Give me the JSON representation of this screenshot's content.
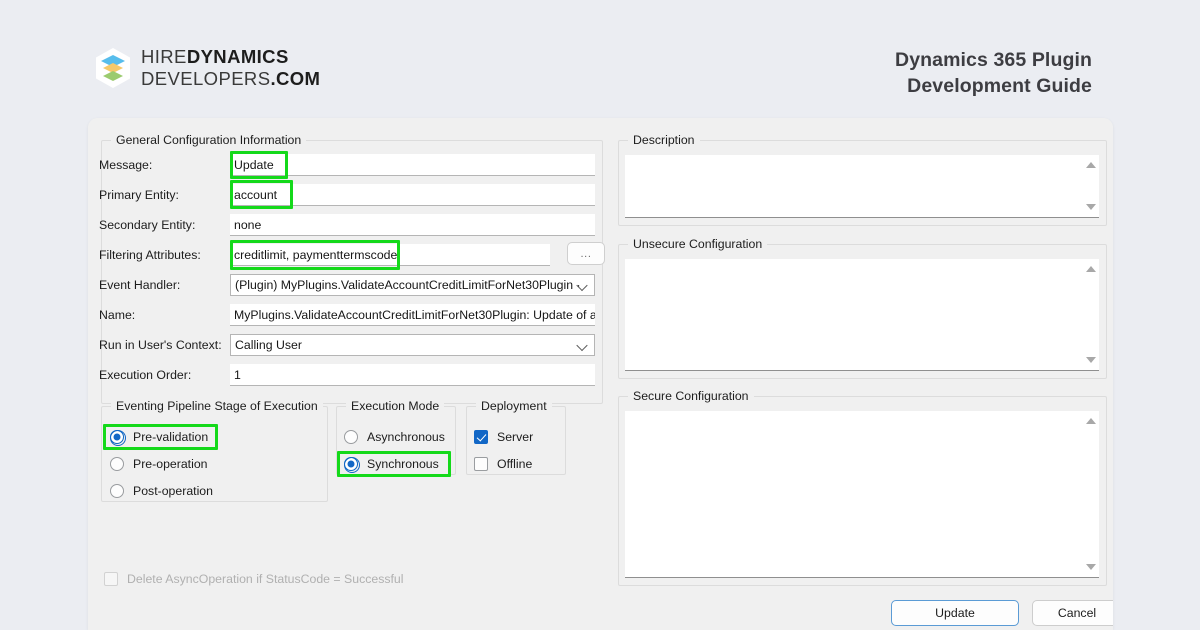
{
  "header": {
    "brand": {
      "logo_icon": "layered-hexagon-logo",
      "line1_light": "HIRE",
      "line1_bold": "DYNAMICS",
      "line2_light": "DEVELOPERS",
      "line2_bold": ".COM"
    },
    "title_line1": "Dynamics 365 Plugin",
    "title_line2": "Development Guide"
  },
  "dialog": {
    "general_group": {
      "title": "General Configuration Information",
      "fields": [
        {
          "label": "Message:",
          "value": "Update",
          "type": "text",
          "highlighted": true
        },
        {
          "label": "Primary Entity:",
          "value": "account",
          "type": "text",
          "highlighted": true
        },
        {
          "label": "Secondary Entity:",
          "value": "none",
          "type": "text",
          "highlighted": false
        },
        {
          "label": "Filtering Attributes:",
          "value": "creditlimit, paymenttermscode",
          "type": "text-browse",
          "highlighted": true
        },
        {
          "label": "Event Handler:",
          "value": "(Plugin) MyPlugins.ValidateAccountCreditLimitForNet30Plugin ·",
          "type": "combo",
          "highlighted": false
        },
        {
          "label": "Name:",
          "value": "MyPlugins.ValidateAccountCreditLimitForNet30Plugin: Update of a",
          "type": "text",
          "highlighted": false
        },
        {
          "label": "Run in User's Context:",
          "value": "Calling User",
          "type": "combo",
          "highlighted": false
        },
        {
          "label": "Execution Order:",
          "value": "1",
          "type": "text",
          "highlighted": false
        }
      ],
      "browse_button_label": "..."
    },
    "pipeline_group": {
      "title": "Eventing Pipeline Stage of Execution",
      "options": [
        {
          "label": "Pre-validation",
          "selected": true,
          "highlighted": true
        },
        {
          "label": "Pre-operation",
          "selected": false,
          "highlighted": false
        },
        {
          "label": "Post-operation",
          "selected": false,
          "highlighted": false
        }
      ]
    },
    "execution_mode_group": {
      "title": "Execution Mode",
      "options": [
        {
          "label": "Asynchronous",
          "selected": false,
          "highlighted": false
        },
        {
          "label": "Synchronous",
          "selected": true,
          "highlighted": true
        }
      ]
    },
    "deployment_group": {
      "title": "Deployment",
      "options": [
        {
          "label": "Server",
          "checked": true
        },
        {
          "label": "Offline",
          "checked": false
        }
      ]
    },
    "delete_async": {
      "label": "Delete AsyncOperation if StatusCode = Successful",
      "checked": false,
      "disabled": true
    },
    "description_group": {
      "title": "Description",
      "value": ""
    },
    "unsecure_group": {
      "title": "Unsecure Configuration",
      "value": ""
    },
    "secure_group": {
      "title": "Secure Configuration",
      "value": ""
    },
    "buttons": {
      "update_label": "Update",
      "cancel_label": "Cancel"
    }
  },
  "colors": {
    "page_background": "#ebedf2",
    "highlight_green": "#14d91a",
    "accent_blue": "#1267c6",
    "dialog_background": "#f0f0f0"
  }
}
